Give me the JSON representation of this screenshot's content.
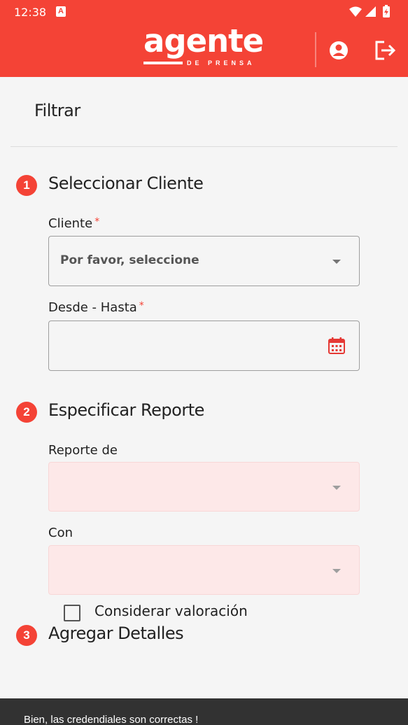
{
  "status_bar": {
    "time": "12:38",
    "notification_badge": "A",
    "icons": [
      "wifi-icon",
      "signal-icon",
      "battery-icon"
    ]
  },
  "header": {
    "logo_main": "agente",
    "logo_sub": "DE PRENSA",
    "accent_color": "#f44336",
    "actions": [
      "account-icon",
      "logout-icon"
    ]
  },
  "filter": {
    "title": "Filtrar",
    "steps": [
      {
        "number": "1",
        "title": "Seleccionar Cliente",
        "fields": [
          {
            "label": "Cliente",
            "required": "*",
            "value": "Por favor, seleccione",
            "type": "select"
          },
          {
            "label": "Desde - Hasta",
            "required": "*",
            "value": "",
            "type": "date-range",
            "icon": "calendar-icon"
          }
        ]
      },
      {
        "number": "2",
        "title": "Especificar Reporte",
        "fields": [
          {
            "label": "Reporte de",
            "value": "",
            "type": "select",
            "disabled": true
          },
          {
            "label": "Con",
            "value": "",
            "type": "select",
            "disabled": true
          }
        ]
      },
      {
        "number": "3",
        "title": "Agregar Detalles",
        "options": [
          {
            "label": "Considerar valoración",
            "checked": false
          }
        ]
      }
    ]
  },
  "snackbar": {
    "message": "Bien, las credendiales son correctas !"
  }
}
